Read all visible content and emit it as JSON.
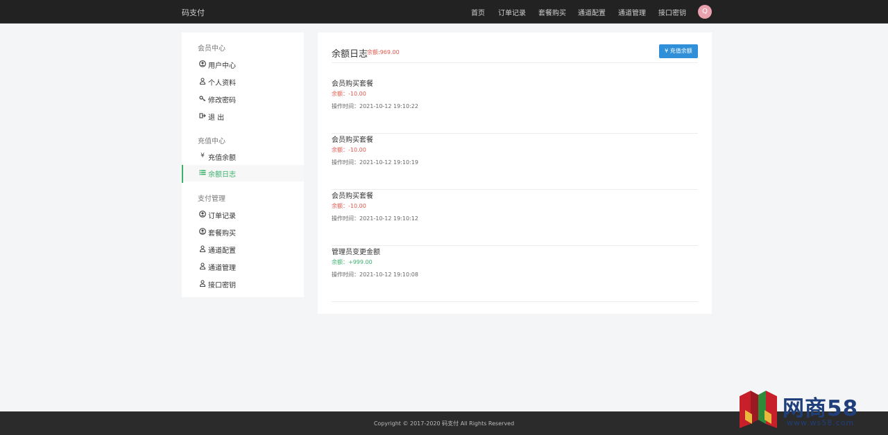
{
  "header": {
    "brand": "码支付",
    "nav": [
      "首页",
      "订单记录",
      "套餐购买",
      "通道配置",
      "通道管理",
      "接口密钥"
    ],
    "avatar_letter": "Q"
  },
  "sidebar": {
    "groups": [
      {
        "title": "会员中心",
        "items": [
          {
            "icon": "user-circle-icon",
            "label": "用户中心"
          },
          {
            "icon": "user-icon",
            "label": "个人资料"
          },
          {
            "icon": "key-icon",
            "label": "修改密码"
          },
          {
            "icon": "logout-icon",
            "label": "退 出"
          }
        ]
      },
      {
        "title": "充值中心",
        "items": [
          {
            "icon": "yen-icon",
            "label": "充值余额"
          },
          {
            "icon": "list-icon",
            "label": "余额日志",
            "active": true
          }
        ]
      },
      {
        "title": "支付管理",
        "items": [
          {
            "icon": "user-circle-icon",
            "label": "订单记录"
          },
          {
            "icon": "user-circle-icon",
            "label": "套餐购买"
          },
          {
            "icon": "user-icon",
            "label": "通道配置"
          },
          {
            "icon": "user-icon",
            "label": "通道管理"
          },
          {
            "icon": "user-icon",
            "label": "接口密钥"
          }
        ]
      }
    ]
  },
  "main": {
    "title": "余额日志",
    "balance": "余额:969.00",
    "recharge_button": "¥ 充值余额",
    "logs": [
      {
        "title": "会员购买套餐",
        "amount": "余额：-10.00",
        "sign": "negative",
        "time": "操作时间：2021-10-12 19:10:22"
      },
      {
        "title": "会员购买套餐",
        "amount": "余额：-10.00",
        "sign": "negative",
        "time": "操作时间：2021-10-12 19:10:19"
      },
      {
        "title": "会员购买套餐",
        "amount": "余额：-10.00",
        "sign": "negative",
        "time": "操作时间：2021-10-12 19:10:12"
      },
      {
        "title": "管理员变更金额",
        "amount": "余额：+999.00",
        "sign": "positive",
        "time": "操作时间：2021-10-12 19:10:08"
      }
    ]
  },
  "footer": {
    "copyright": "Copyright © 2017-2020 码支付 All Rights Reserved"
  },
  "watermark": {
    "title": "网商58",
    "url": "www.ws58.com"
  },
  "colors": {
    "accent_green": "#3bb16b",
    "danger_red": "#e2574c",
    "button_blue": "#2f8fd8",
    "topbar": "#222222"
  }
}
